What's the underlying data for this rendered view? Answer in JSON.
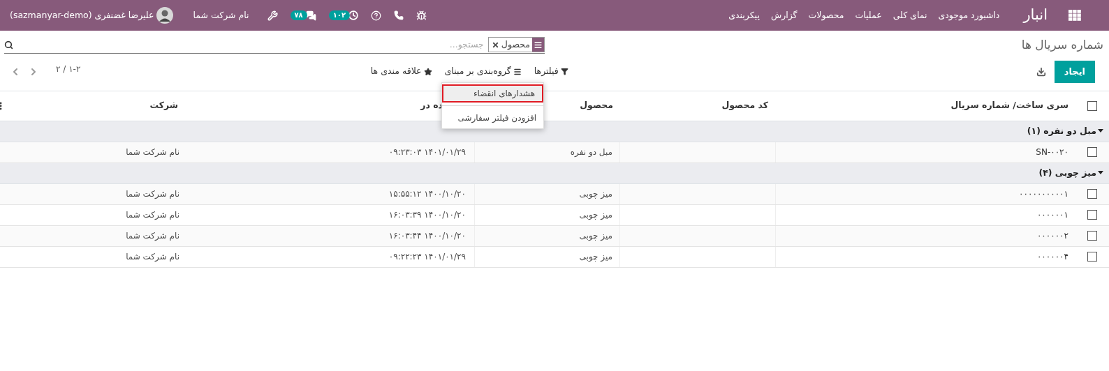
{
  "navbar": {
    "app_title": "انبار",
    "menu": [
      "داشبورد موجودی",
      "نمای کلی",
      "عملیات",
      "محصولات",
      "گزارش",
      "پیکربندی"
    ],
    "activity_badge": "۱۰۲",
    "messages_badge": "۷۸",
    "company": "نام شرکت شما",
    "user": "علیرضا غضنفری (sazmanyar-demo)"
  },
  "control_panel": {
    "title": "شماره سریال ها",
    "search": {
      "facet": "محصول",
      "placeholder": "جستجو..."
    },
    "create_button": "ایجاد",
    "filters": "فیلترها",
    "group_by": "گروه‌بندی بر مبنای",
    "favorites": "علاقه مندی ها",
    "pager": "۱-۲ / ۲"
  },
  "filter_menu": {
    "items": [
      {
        "label": "هشدارهای انقضاء",
        "selected": true
      },
      {
        "label": "افزودن فیلتر سفارشی",
        "selected": false
      }
    ]
  },
  "table": {
    "select_all_checked": false,
    "columns": [
      "سری ساخت/ شماره سریال",
      "کد محصول",
      "محصول",
      "ده در",
      "شرکت"
    ],
    "groups": [
      {
        "label": "مبل دو نفره (۱)",
        "expanded": true,
        "rows": [
          {
            "checked": false,
            "serial": "SN-۰۰۲۰",
            "product": "مبل دو نفره",
            "date": "۱۴۰۱/۰۱/۲۹ ۰۹:۲۳:۰۳",
            "company": "نام شرکت شما"
          }
        ]
      },
      {
        "label": "میز چوبی (۴)",
        "expanded": true,
        "rows": [
          {
            "checked": false,
            "serial": "۰۰۰۰۰۰۰۰۰۰۱",
            "product": "میز چوبی",
            "date": "۱۴۰۰/۱۰/۲۰ ۱۵:۵۵:۱۲",
            "company": "نام شرکت شما"
          },
          {
            "checked": false,
            "serial": "۰۰۰۰۰۰۱",
            "product": "میز چوبی",
            "date": "۱۴۰۰/۱۰/۲۰ ۱۶:۰۳:۳۹",
            "company": "نام شرکت شما"
          },
          {
            "checked": false,
            "serial": "۰۰۰۰۰۰۲",
            "product": "میز چوبی",
            "date": "۱۴۰۰/۱۰/۲۰ ۱۶:۰۳:۴۴",
            "company": "نام شرکت شما"
          },
          {
            "checked": false,
            "serial": "۰۰۰۰۰۰۴",
            "product": "میز چوبی",
            "date": "۱۴۰۱/۰۱/۲۹ ۰۹:۲۲:۲۳",
            "company": "نام شرکت شما"
          }
        ]
      }
    ]
  }
}
